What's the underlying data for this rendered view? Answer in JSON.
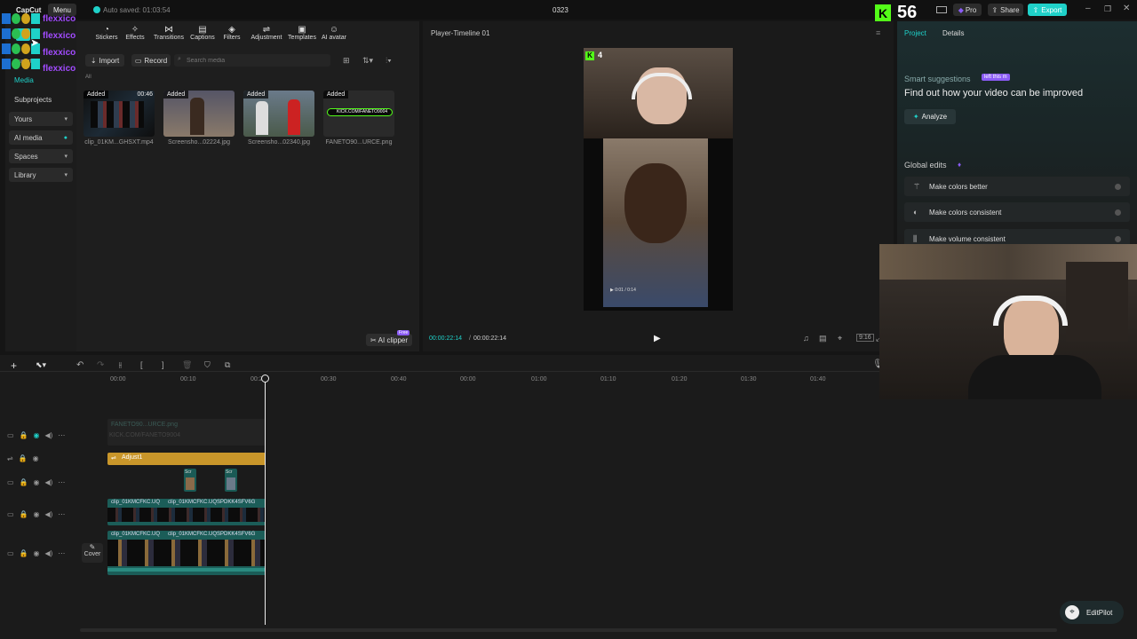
{
  "titlebar": {
    "app_name": "CapCut",
    "menu_label": "Menu",
    "autosave": "Auto saved: 01:03:54",
    "project_name": "0323",
    "pro_label": "Pro",
    "share_label": "Share",
    "export_label": "Export"
  },
  "overlay": {
    "streamer_names": [
      "flexxico",
      "flexxico",
      "flexxico",
      "flexxico"
    ],
    "viewer_count": "56",
    "kick_count": "4"
  },
  "sidebar": {
    "import_label": "Import",
    "media_label": "Media",
    "items": [
      {
        "label": "Subprojects"
      },
      {
        "label": "Yours"
      },
      {
        "label": "AI media"
      },
      {
        "label": "Spaces"
      },
      {
        "label": "Library"
      }
    ]
  },
  "media_panel": {
    "tools": [
      {
        "label": "Stickers",
        "icon": "sticker-icon"
      },
      {
        "label": "Effects",
        "icon": "effects-icon"
      },
      {
        "label": "Transitions",
        "icon": "transitions-icon"
      },
      {
        "label": "Captions",
        "icon": "captions-icon"
      },
      {
        "label": "Filters",
        "icon": "filters-icon"
      },
      {
        "label": "Adjustment",
        "icon": "adjustment-icon"
      },
      {
        "label": "Templates",
        "icon": "templates-icon"
      },
      {
        "label": "AI avatar",
        "icon": "ai-avatar-icon"
      }
    ],
    "tab_all": "All",
    "import_btn": "Import",
    "record_btn": "Record",
    "search_placeholder": "Search media",
    "items": [
      {
        "badge": "Added",
        "name": "clip_01KM...GHSXT.mp4",
        "duration": "00:46"
      },
      {
        "badge": "Added",
        "name": "Screensho...02224.jpg",
        "duration": ""
      },
      {
        "badge": "Added",
        "name": "Screensho...02340.jpg",
        "duration": ""
      },
      {
        "badge": "Added",
        "name": "FANETO90...URCE.png",
        "duration": ""
      }
    ],
    "ai_clipper_label": "AI clipper",
    "ai_clipper_badge": "Free",
    "kick_banner_text": "KICK.COM/FANETO9004"
  },
  "player": {
    "title": "Player-Timeline 01",
    "current_time": "00:00:22:14",
    "total_time": "00:00:22:14",
    "ratio_label": "9:16",
    "inner_time": "0:01 / 0:14"
  },
  "right_panel": {
    "tabs": [
      "Project",
      "Details"
    ],
    "smart_title": "Smart suggestions",
    "smart_badge": "left this m",
    "smart_subtitle": "Find out how your video can be improved",
    "analyze_label": "Analyze",
    "global_title": "Global edits",
    "global_items": [
      {
        "label": "Make colors better",
        "icon": "magic-wand-icon"
      },
      {
        "label": "Make colors consistent",
        "icon": "color-match-icon"
      },
      {
        "label": "Make volume consistent",
        "icon": "volume-eq-icon"
      }
    ]
  },
  "timeline": {
    "ruler": [
      "00:00",
      "00:10",
      "00:20",
      "00:30",
      "00:40",
      "00:00",
      "01:00",
      "01:10",
      "01:20",
      "01:30",
      "01:40"
    ],
    "text_track_label": "FANETO90...URCE.png",
    "text_track_label2": "KICK.COM/FANETO9004",
    "adjust_label": "Adjust1",
    "small_clip1": "Scr",
    "small_clip2": "Scr",
    "video_clip1": "clip_01KMCFKC.UQ",
    "video_clip2": "clip_01KMCFKC.UQSPDKK4SFV6G",
    "video_clip3": "clip_01KMCFKC.UQ",
    "video_clip4": "clip_01KMCFKC.UQSPDKK4SFV6G",
    "cover_label": "Cover"
  },
  "editpilot_label": "EditPilot",
  "colors": {
    "accent": "#1fd1c9",
    "kick_green": "#53fc18",
    "adjust_orange": "#c9962a",
    "purple": "#8b5cf6"
  }
}
